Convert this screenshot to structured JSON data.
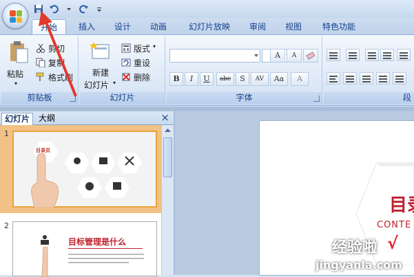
{
  "tabs": [
    "开始",
    "插入",
    "设计",
    "动画",
    "幻灯片放映",
    "审阅",
    "视图",
    "特色功能"
  ],
  "clipboard": {
    "paste_label": "粘贴",
    "cut_label": "剪切",
    "copy_label": "复制",
    "format_painter_label": "格式刷",
    "group_label": "剪贴板"
  },
  "slides_group": {
    "new_slide_line1": "新建",
    "new_slide_line2": "幻灯片",
    "layout_label": "版式",
    "reset_label": "重设",
    "delete_label": "删除",
    "group_label": "幻灯片"
  },
  "font_group": {
    "font_name": "",
    "font_size": "",
    "grow_label": "A",
    "shrink_label": "A",
    "bold": "B",
    "italic": "I",
    "underline": "U",
    "strike": "abc",
    "shadow": "S",
    "spacing": "AV",
    "case": "Aa",
    "color": "A",
    "group_label": "字体"
  },
  "paragraph_group": {
    "group_label": "段"
  },
  "panel": {
    "tab_slides": "幻灯片",
    "tab_outline": "大纲",
    "close": "×"
  },
  "slides": [
    {
      "number": "1",
      "title": "目录页"
    },
    {
      "number": "2",
      "title": "目标管理是什么"
    }
  ],
  "slide_canvas": {
    "title_partial": "目录",
    "subtitle_partial": "CONTE"
  },
  "watermark": {
    "text": "经验啦",
    "check": "√",
    "url": "jingyanla.com"
  },
  "colors": {
    "accent_red": "#c0212e",
    "ribbon_text": "#15428b",
    "selected_slide": "#f2c185",
    "arrow": "#e2392f"
  }
}
